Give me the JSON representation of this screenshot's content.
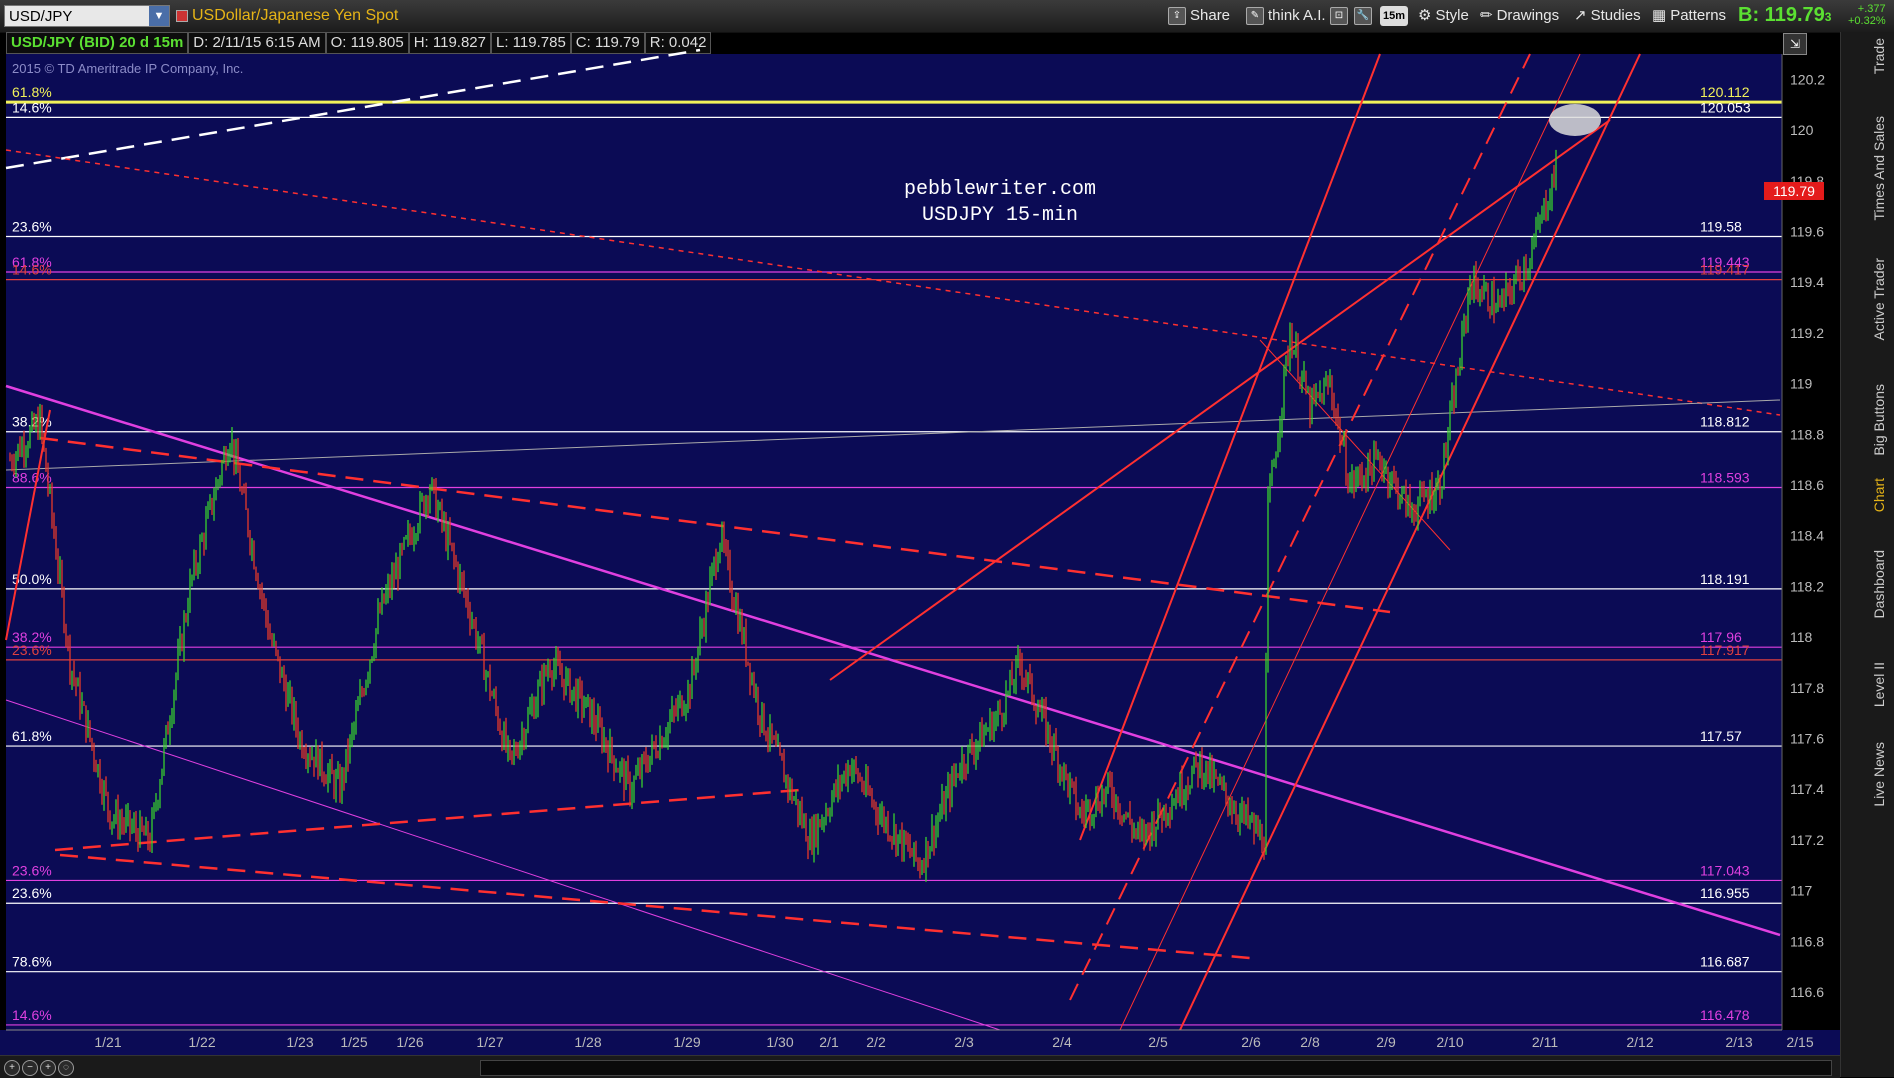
{
  "toolbar": {
    "symbol": "USD/JPY",
    "instrument_name": "USDollar/Japanese Yen Spot",
    "share": "Share",
    "think": "think A.I.",
    "timeframe": "15m",
    "style": "Style",
    "drawings": "Drawings",
    "studies": "Studies",
    "patterns": "Patterns",
    "bid_label": "B:",
    "bid_value": "119.79",
    "bid_sub": "3",
    "change_1": "+.377",
    "change_2": "+0.32%"
  },
  "infobar": {
    "title": "USD/JPY (BID) 20 d 15m",
    "date": "D: 2/11/15 6:15 AM",
    "open": "O: 119.805",
    "high": "H: 119.827",
    "low": "L: 119.785",
    "close": "C: 119.79",
    "range": "R: 0.042"
  },
  "chart": {
    "copyright": "2015 © TD Ameritrade IP Company, Inc.",
    "watermark_1": "pebblewriter.com",
    "watermark_2": "USDJPY 15-min",
    "current_price_tag": "119.79",
    "y_ticks": [
      "120.2",
      "120",
      "119.8",
      "119.6",
      "119.4",
      "119.2",
      "119",
      "118.8",
      "118.6",
      "118.4",
      "118.2",
      "118",
      "117.8",
      "117.6",
      "117.4",
      "117.2",
      "117",
      "116.8",
      "116.6"
    ],
    "x_ticks": [
      "1/21",
      "1/22",
      "1/23",
      "1/25",
      "1/26",
      "1/27",
      "1/28",
      "1/29",
      "1/30",
      "2/1",
      "2/2",
      "2/3",
      "2/4",
      "2/5",
      "2/6",
      "2/8",
      "2/9",
      "2/10",
      "2/11",
      "2/12",
      "2/13",
      "2/15"
    ],
    "fib_levels": [
      {
        "pct": "61.8%",
        "price": "120.11",
        "sub": "2",
        "color": "#f2f25a"
      },
      {
        "pct": "14.6%",
        "price": "120.05",
        "sub": "3",
        "color": "#ffffff"
      },
      {
        "pct": "23.6%",
        "price": "119.58",
        "sub": "",
        "color": "#ffffff"
      },
      {
        "pct": "61.8%",
        "price": "119.44",
        "sub": "3",
        "color": "#e040e0"
      },
      {
        "pct": "14.6%",
        "price": "119.41",
        "sub": "7",
        "color": "#e04040"
      },
      {
        "pct": "38.2%",
        "price": "118.81",
        "sub": "2",
        "color": "#ffffff"
      },
      {
        "pct": "88.6%",
        "price": "118.59",
        "sub": "3",
        "color": "#e040e0"
      },
      {
        "pct": "50.0%",
        "price": "118.19",
        "sub": "1",
        "color": "#ffffff"
      },
      {
        "pct": "38.2%",
        "price": "117.96",
        "sub": "",
        "color": "#e040e0"
      },
      {
        "pct": "23.6%",
        "price": "117.91",
        "sub": "7",
        "color": "#e04040"
      },
      {
        "pct": "61.8%",
        "price": "117.57",
        "sub": "",
        "color": "#ffffff"
      },
      {
        "pct": "23.6%",
        "price": "117.04",
        "sub": "3",
        "color": "#e040e0"
      },
      {
        "pct": "23.6%",
        "price": "116.95",
        "sub": "5",
        "color": "#ffffff"
      },
      {
        "pct": "78.6%",
        "price": "116.68",
        "sub": "7",
        "color": "#ffffff"
      },
      {
        "pct": "14.6%",
        "price": "116.47",
        "sub": "8",
        "color": "#e040e0"
      }
    ]
  },
  "side_tabs": [
    "Trade",
    "Times And Sales",
    "Active Trader",
    "Big Buttons",
    "Chart",
    "Dashboard",
    "Level II",
    "Live News"
  ],
  "colors": {
    "chart_bg": "#0b0b55",
    "up": "#39d12e",
    "down": "#e83a2a",
    "fib_yellow": "#f2f25a",
    "magenta": "#e040e0",
    "red_line": "#ff3030"
  }
}
